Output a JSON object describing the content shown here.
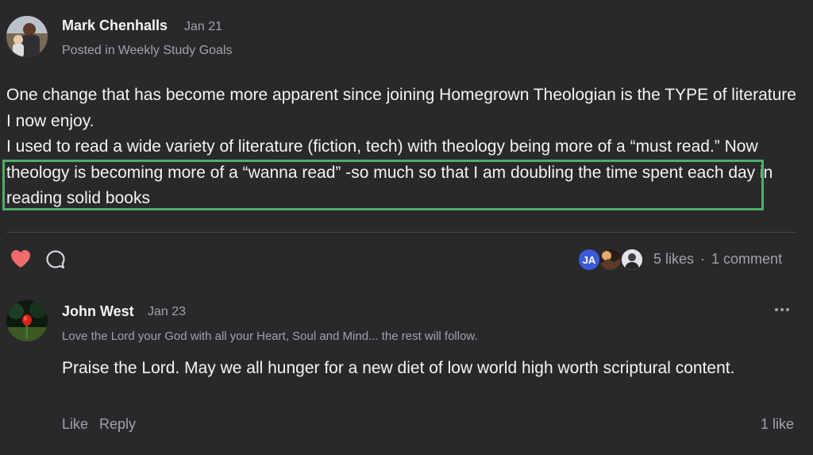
{
  "post": {
    "author": "Mark Chenhalls",
    "date": "Jan 21",
    "posted_in_prefix": "Posted in",
    "category": "Weekly Study Goals",
    "body": [
      "One change that has become more apparent since joining Homegrown Theologian is the TYPE of literature I now enjoy.",
      "I used to read a wide variety of literature (fiction, tech) with theology being more of a “must read.” Now theology is becoming more of a “wanna read” -so much so that I am doubling the time spent each day in reading solid books"
    ],
    "likers": [
      {
        "initials": "JA",
        "color": "#3b5bdb"
      },
      {
        "initials": "",
        "color": "#3a2a22"
      },
      {
        "initials": "",
        "color": "#d4d4d8"
      }
    ],
    "likes_label": "5 likes",
    "separator": "·",
    "comments_label": "1 comment",
    "liked": true,
    "like_color": "#f26b6b",
    "highlight_color": "#4fae6a"
  },
  "comment": {
    "author": "John West",
    "date": "Jan 23",
    "bio": "Love the Lord your God with all your Heart, Soul and Mind... the rest will follow.",
    "text": "Praise the Lord. May we all hunger for a new diet of low world high worth scriptural content.",
    "like_label": "Like",
    "reply_label": "Reply",
    "likes_count_label": "1 like"
  },
  "icons": {
    "like": "heart-icon",
    "comment": "speech-bubble-icon",
    "more": "more-horizontal-icon"
  }
}
